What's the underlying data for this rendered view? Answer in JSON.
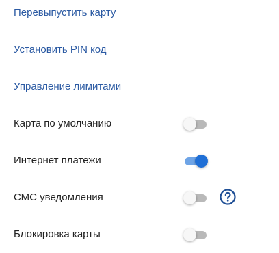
{
  "links": {
    "reissue_card": "Перевыпустить карту",
    "set_pin": "Установить PIN код",
    "manage_limits": "Управление лимитами"
  },
  "settings": [
    {
      "label": "Карта по умолчанию",
      "enabled": false
    },
    {
      "label": "Интернет платежи",
      "enabled": true
    },
    {
      "label": "СМС уведомления",
      "enabled": false,
      "help_icon": "question-circle-icon"
    },
    {
      "label": "Блокировка карты",
      "enabled": false
    }
  ],
  "colors": {
    "link": "#2b5aa3",
    "text": "#222222",
    "toggle_on_knob": "#1f6fd6",
    "toggle_on_track": "#6ea4e6",
    "toggle_off_track": "#b9b9b9",
    "help_icon": "#1f4f96"
  }
}
